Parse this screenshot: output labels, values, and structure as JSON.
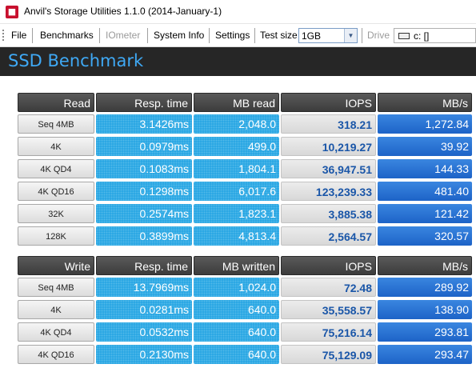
{
  "window": {
    "title": "Anvil's Storage Utilities 1.1.0 (2014-January-1)",
    "app_icon": "anvil-app-icon"
  },
  "menu": {
    "items": [
      "File",
      "Benchmarks",
      "IOmeter",
      "System Info",
      "Settings"
    ],
    "test_size_label": "Test size",
    "test_size_value": "1GB",
    "drive_label": "Drive",
    "drive_value": "c: []"
  },
  "header": {
    "title": "SSD Benchmark"
  },
  "colors": {
    "header_bg": "#262626",
    "title_accent": "#3fa9f5",
    "cyan_cell": "#23a5e3",
    "blue_cell": "#1d63c7",
    "iops_text": "#1a56a8"
  },
  "read": {
    "headers": [
      "Read",
      "Resp. time",
      "MB read",
      "IOPS",
      "MB/s"
    ],
    "rows": [
      [
        "Seq 4MB",
        "3.1426ms",
        "2,048.0",
        "318.21",
        "1,272.84"
      ],
      [
        "4K",
        "0.0979ms",
        "499.0",
        "10,219.27",
        "39.92"
      ],
      [
        "4K QD4",
        "0.1083ms",
        "1,804.1",
        "36,947.51",
        "144.33"
      ],
      [
        "4K QD16",
        "0.1298ms",
        "6,017.6",
        "123,239.33",
        "481.40"
      ],
      [
        "32K",
        "0.2574ms",
        "1,823.1",
        "3,885.38",
        "121.42"
      ],
      [
        "128K",
        "0.3899ms",
        "4,813.4",
        "2,564.57",
        "320.57"
      ]
    ]
  },
  "write": {
    "headers": [
      "Write",
      "Resp. time",
      "MB written",
      "IOPS",
      "MB/s"
    ],
    "rows": [
      [
        "Seq 4MB",
        "13.7969ms",
        "1,024.0",
        "72.48",
        "289.92"
      ],
      [
        "4K",
        "0.0281ms",
        "640.0",
        "35,558.57",
        "138.90"
      ],
      [
        "4K QD4",
        "0.0532ms",
        "640.0",
        "75,216.14",
        "293.81"
      ],
      [
        "4K QD16",
        "0.2130ms",
        "640.0",
        "75,129.09",
        "293.47"
      ]
    ]
  }
}
